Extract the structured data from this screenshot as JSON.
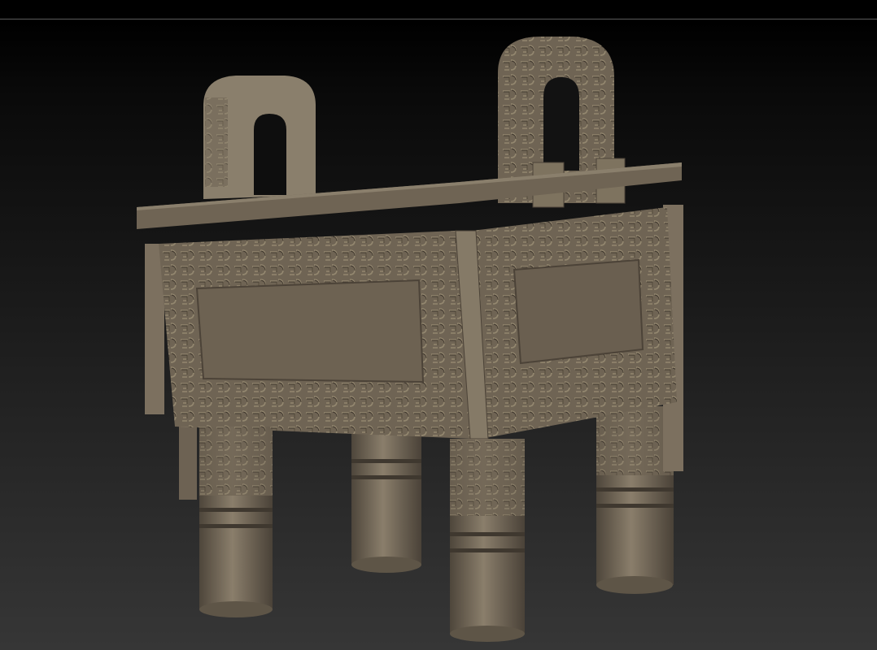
{
  "viewport": {
    "model": "bronze-ding-vessel",
    "colors": {
      "model_light": "#8f8370",
      "model_mid": "#756a5a",
      "model_dark": "#4f463b",
      "divider": "#5a5a5a"
    }
  }
}
